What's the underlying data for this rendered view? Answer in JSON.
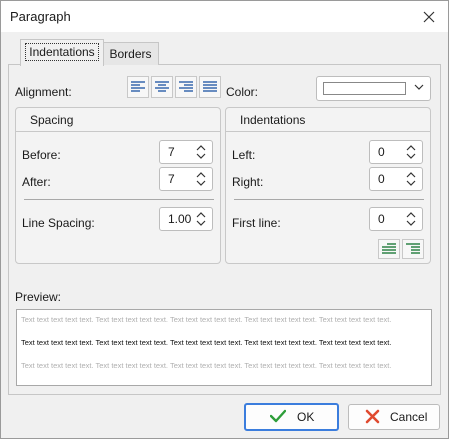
{
  "window": {
    "title": "Paragraph"
  },
  "tabs": [
    {
      "label": "Indentations",
      "active": true
    },
    {
      "label": "Borders",
      "active": false
    }
  ],
  "alignment": {
    "label": "Alignment:",
    "buttons": [
      "align-left-icon",
      "align-center-icon",
      "align-right-icon",
      "align-justify-icon"
    ]
  },
  "color": {
    "label": "Color:",
    "value": "#ffffff"
  },
  "spacing": {
    "title": "Spacing",
    "before_label": "Before:",
    "before_value": "7",
    "after_label": "After:",
    "after_value": "7",
    "line_label": "Line Spacing:",
    "line_value": "1.00"
  },
  "indentations": {
    "title": "Indentations",
    "left_label": "Left:",
    "left_value": "0",
    "right_label": "Right:",
    "right_value": "0",
    "first_label": "First line:",
    "first_value": "0"
  },
  "preview": {
    "label": "Preview:",
    "before_text": "Text text text text text. Text text text text text. Text text text text text. Text text text text text. Text text text text text.",
    "sample_text": "Text text text text text. Text text text text text. Text text text text text. Text text text text text. Text text text text text.",
    "after_text": "Text text text text text. Text text text text text. Text text text text text. Text text text text text. Text text text text text."
  },
  "buttons": {
    "ok": "OK",
    "cancel": "Cancel"
  },
  "colors": {
    "accent": "#3b7ddd",
    "ok_check": "#2e9e3a",
    "cancel_x": "#e04a2f",
    "align_icon": "#2b5fa8",
    "indent_icon": "#1f7a3a"
  }
}
